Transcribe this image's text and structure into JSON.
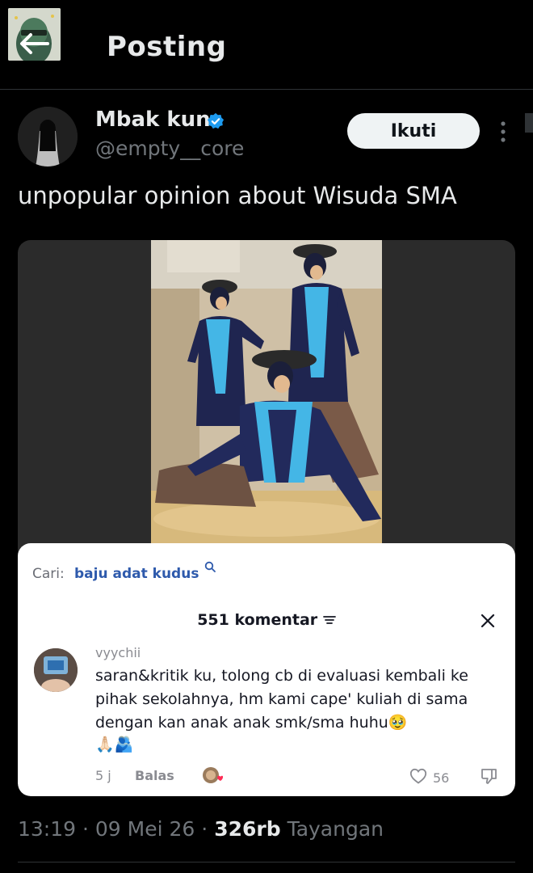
{
  "header": {
    "title": "Posting"
  },
  "author": {
    "name": "Mbak kun",
    "handle": "@empty__core",
    "follow_label": "Ikuti"
  },
  "tweet": {
    "text": "unpopular opinion about Wisuda SMA"
  },
  "comment_card": {
    "search_label": "Cari:",
    "search_query": "baju adat kudus",
    "comments_count": "551 komentar",
    "comment": {
      "username": "vyychii",
      "text": "saran&kritik ku, tolong cb di evaluasi kembali ke pihak sekolahnya, hm kami cape' kuliah di sama dengan kan anak anak smk/sma huhu🥹",
      "emoji_line": "🙏🏻🫂",
      "time": "5 j",
      "reply_label": "Balas",
      "likes": "56"
    }
  },
  "meta": {
    "time": "13:19",
    "date": "09 Mei 26",
    "views": "326rb",
    "views_label": "Tayangan"
  },
  "colors": {
    "background": "#000000",
    "accent_verified": "#1d9bf0",
    "muted": "#71767b",
    "link_blue": "#2e5aac"
  }
}
